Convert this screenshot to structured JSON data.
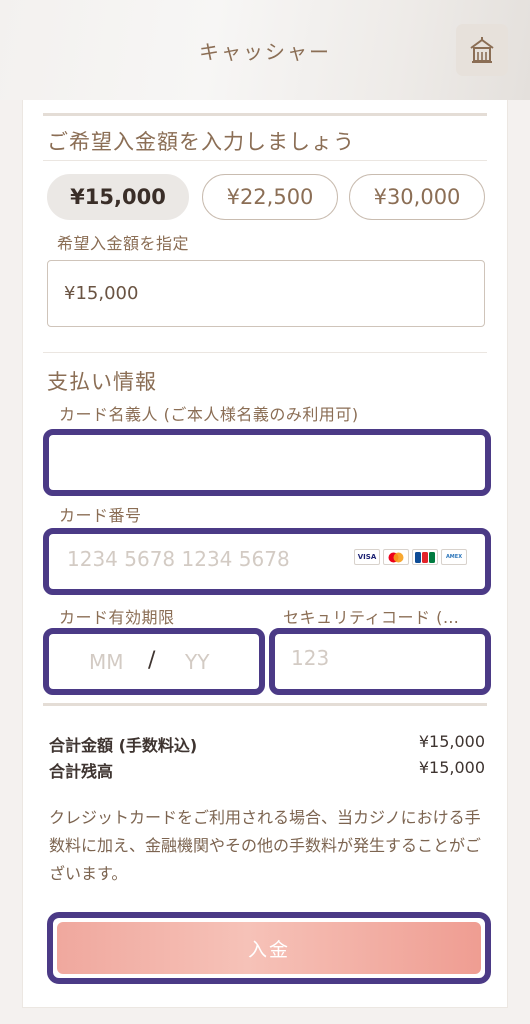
{
  "header": {
    "title": "キャッシャー",
    "home_icon": "home-icon"
  },
  "amount_section": {
    "title": "ご希望入金額を入力しましょう",
    "options": [
      "¥15,000",
      "¥22,500",
      "¥30,000"
    ],
    "selected_index": 0,
    "custom_label": "希望入金額を指定",
    "custom_value": "¥15,000"
  },
  "payment": {
    "title": "支払い情報",
    "holder_label": "カード名義人 (ご本人様名義のみ利用可)",
    "holder_value": "",
    "number_label": "カード番号",
    "number_placeholder": "1234 5678 1234 5678",
    "card_brands": [
      "VISA",
      "MC",
      "JCB",
      "AMEX"
    ],
    "expiry_label": "カード有効期限",
    "expiry_mm": "MM",
    "expiry_sep": "/",
    "expiry_yy": "YY",
    "cvc_label": "セキュリティコード (…",
    "cvc_placeholder": "123"
  },
  "summary": {
    "total_label": "合計金額 (手数料込)",
    "total_value": "¥15,000",
    "balance_label": "合計残高",
    "balance_value": "¥15,000"
  },
  "note": "クレジットカードをご利用される場合、当カジノにおける手数料に加え、金融機関やその他の手数料が発生することがございます。",
  "submit_label": "入金",
  "colors": {
    "accent_text": "#8b6e55",
    "focus_border": "#4b3a86",
    "button_gradient": "#f0a89e"
  }
}
